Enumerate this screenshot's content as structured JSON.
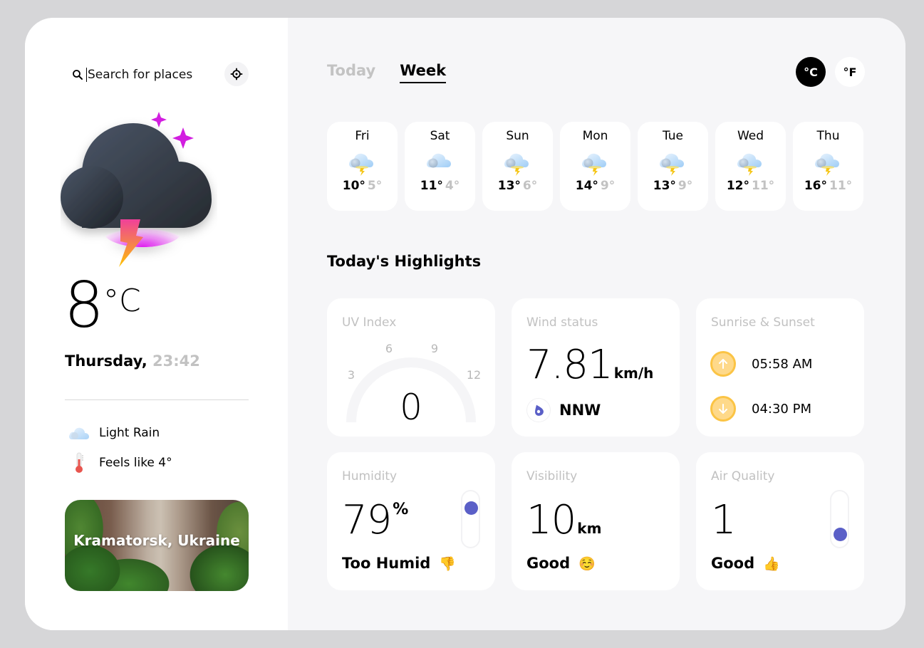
{
  "search": {
    "placeholder": "Search for places",
    "value": ""
  },
  "current": {
    "temperature": "8",
    "unit": "°C",
    "day": "Thursday,",
    "time": "23:42",
    "condition": "Light Rain",
    "feels_like": "Feels like 4°",
    "city": "Kramatorsk, Ukraine",
    "icon": "thunderstorm-cloud-icon"
  },
  "tabs": [
    {
      "label": "Today",
      "active": false
    },
    {
      "label": "Week",
      "active": true
    }
  ],
  "units": {
    "celsius": "°C",
    "fahrenheit": "°F",
    "selected": "celsius"
  },
  "week": [
    {
      "day": "Fri",
      "high": "10°",
      "low": "5°",
      "icon": "thunder-cloud-icon"
    },
    {
      "day": "Sat",
      "high": "11°",
      "low": "4°",
      "icon": "cloud-icon"
    },
    {
      "day": "Sun",
      "high": "13°",
      "low": "6°",
      "icon": "thunder-cloud-icon"
    },
    {
      "day": "Mon",
      "high": "14°",
      "low": "9°",
      "icon": "thunder-cloud-icon"
    },
    {
      "day": "Tue",
      "high": "13°",
      "low": "9°",
      "icon": "thunder-cloud-icon"
    },
    {
      "day": "Wed",
      "high": "12°",
      "low": "11°",
      "icon": "thunder-cloud-icon"
    },
    {
      "day": "Thu",
      "high": "16°",
      "low": "11°",
      "icon": "thunder-cloud-icon"
    }
  ],
  "highlights": {
    "title": "Today's Highlights",
    "uv": {
      "label": "UV Index",
      "value": "0",
      "ticks": [
        "3",
        "6",
        "9",
        "12"
      ],
      "fraction": 0
    },
    "wind": {
      "label": "Wind status",
      "value": "7.81",
      "unit": "km/h",
      "direction": "NNW"
    },
    "sun": {
      "label": "Sunrise & Sunset",
      "sunrise": "05:58 AM",
      "sunset": "04:30 PM"
    },
    "humidity": {
      "label": "Humidity",
      "value": "79",
      "unit": "%",
      "status": "Too Humid",
      "emoji": "👎",
      "level": 0.79
    },
    "visibility": {
      "label": "Visibility",
      "value": "10",
      "unit": "km",
      "status": "Good",
      "emoji": "☺️"
    },
    "air": {
      "label": "Air Quality",
      "value": "1",
      "status": "Good",
      "emoji": "👍",
      "level": 0.1
    }
  },
  "colors": {
    "accent": "#5a5fc7",
    "sun": "#fbc445",
    "muted": "#c1c1c1",
    "lightning_top": "#d21ee0",
    "lightning_bottom": "#ffc400"
  }
}
